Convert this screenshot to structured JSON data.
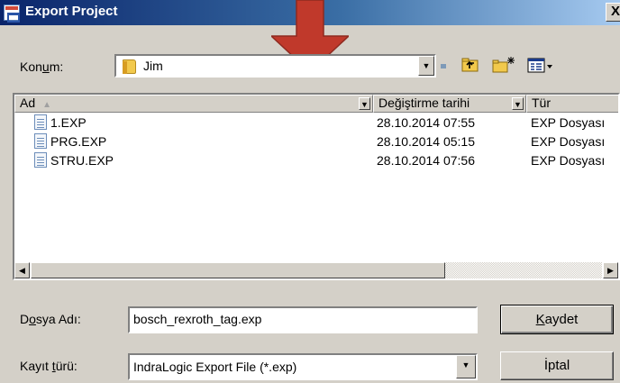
{
  "window": {
    "title": "Export Project",
    "close_glyph": "X"
  },
  "location": {
    "label_pre": "Kon",
    "label_mn": "u",
    "label_post": "m:",
    "value": "Jim",
    "folder_icon": "folder-icon"
  },
  "toolbar": {
    "up_icon": "up-folder-icon",
    "new_folder_icon": "new-folder-icon",
    "view_menu_icon": "view-menu-icon"
  },
  "file_list": {
    "columns": [
      {
        "label": "Ad"
      },
      {
        "label": "Değiştirme tarihi"
      },
      {
        "label": "Tür"
      }
    ],
    "rows": [
      {
        "name": "1.EXP",
        "modified": "28.10.2014 07:55",
        "type": "EXP Dosyası"
      },
      {
        "name": "PRG.EXP",
        "modified": "28.10.2014 05:15",
        "type": "EXP Dosyası"
      },
      {
        "name": "STRU.EXP",
        "modified": "28.10.2014 07:56",
        "type": "EXP Dosyası"
      }
    ]
  },
  "filename": {
    "label_pre": "D",
    "label_mn": "o",
    "label_post": "sya Adı:",
    "value": "bosch_rexroth_tag.exp"
  },
  "filetype": {
    "label_pre": "Kayıt ",
    "label_mn": "t",
    "label_post": "ürü:",
    "value": "IndraLogic Export File (*.exp)"
  },
  "buttons": {
    "save_mn": "K",
    "save_rest": "aydet",
    "cancel": "İptal"
  },
  "colors": {
    "titlebar_start": "#0a246a",
    "titlebar_end": "#a6caf0",
    "face": "#d4d0c8",
    "annotation_arrow": "#c0392b"
  }
}
